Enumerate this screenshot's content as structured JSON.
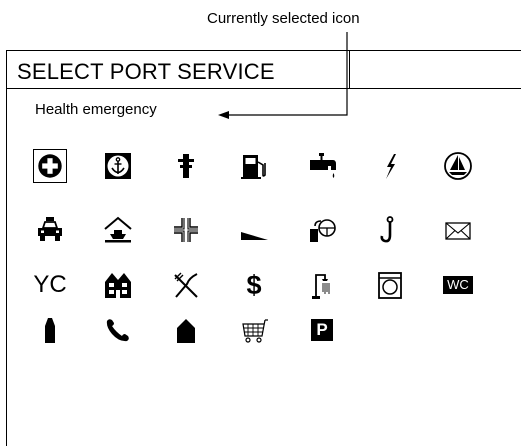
{
  "callout": {
    "text": "Currently selected icon"
  },
  "window": {
    "title": "SELECT PORT SERVICE"
  },
  "selected_service": {
    "label": "Health emergency"
  },
  "icons": [
    {
      "name": "health-emergency-icon",
      "selected": true
    },
    {
      "name": "anchor-icon"
    },
    {
      "name": "mooring-post-icon"
    },
    {
      "name": "fuel-pump-icon"
    },
    {
      "name": "water-tap-icon"
    },
    {
      "name": "electricity-icon"
    },
    {
      "name": "sailboat-icon"
    },
    {
      "name": "taxi-icon"
    },
    {
      "name": "boat-shelter-icon"
    },
    {
      "name": "berth-slip-icon"
    },
    {
      "name": "slipway-ramp-icon"
    },
    {
      "name": "gas-bottle-icon"
    },
    {
      "name": "hook-icon"
    },
    {
      "name": "mail-icon"
    },
    {
      "name": "yacht-club-icon",
      "text": "YC"
    },
    {
      "name": "accommodation-icon"
    },
    {
      "name": "restaurant-icon"
    },
    {
      "name": "exchange-icon",
      "text": "$"
    },
    {
      "name": "shower-icon"
    },
    {
      "name": "laundry-icon"
    },
    {
      "name": "toilet-icon",
      "text": "WC"
    },
    {
      "name": "bottle-icon"
    },
    {
      "name": "telephone-icon"
    },
    {
      "name": "waste-bin-icon"
    },
    {
      "name": "shopping-cart-icon"
    },
    {
      "name": "parking-icon",
      "text": "P"
    }
  ]
}
